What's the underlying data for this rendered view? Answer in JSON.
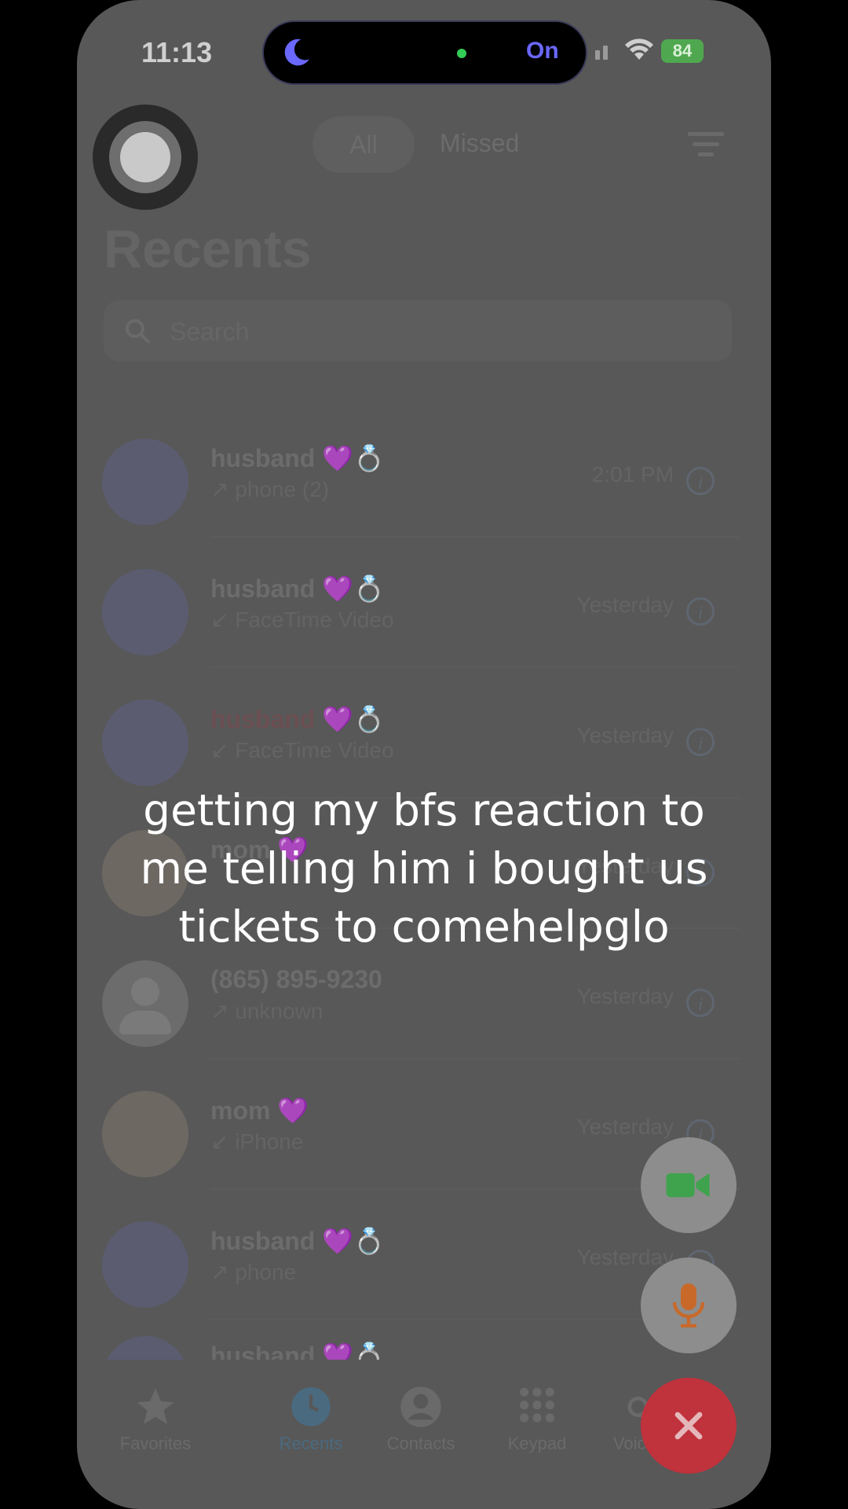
{
  "status_bar": {
    "time": "11:13",
    "focus_label": "On",
    "battery": "84"
  },
  "header": {
    "segments": [
      "All",
      "Missed"
    ],
    "title": "Recents"
  },
  "search": {
    "placeholder": "Search"
  },
  "calls": [
    {
      "name": "husband 💜💍",
      "detail": "↗ phone (2)",
      "time": "2:01 PM",
      "missed": false,
      "avatar": "contact"
    },
    {
      "name": "husband 💜💍",
      "detail": "↙ FaceTime Video",
      "time": "Yesterday",
      "missed": false,
      "avatar": "contact"
    },
    {
      "name": "husband 💜💍",
      "detail": "↙ FaceTime Video",
      "time": "Yesterday",
      "missed": true,
      "avatar": "contact"
    },
    {
      "name": "mom 💜",
      "detail": "",
      "time": "Yesterday",
      "missed": false,
      "avatar": "photo"
    },
    {
      "name": "(865) 895-9230",
      "detail": "↗ unknown",
      "time": "Yesterday",
      "missed": false,
      "avatar": "generic"
    },
    {
      "name": "mom 💜",
      "detail": "↙ iPhone",
      "time": "Yesterday",
      "missed": false,
      "avatar": "photo"
    },
    {
      "name": "husband 💜💍",
      "detail": "↗ phone",
      "time": "Yesterday",
      "missed": false,
      "avatar": "contact"
    },
    {
      "name": "husband 💜💍",
      "detail": "",
      "time": "",
      "missed": false,
      "avatar": "contact"
    }
  ],
  "tabs": [
    "Favorites",
    "Recents",
    "Contacts",
    "Keypad",
    "Voicemail"
  ],
  "overlay": {
    "caption_lines": [
      "getting my bfs reaction to",
      "me telling him i bought us",
      "tickets to comehelpglo"
    ]
  },
  "colors": {
    "focus_accent": "#6a68ff",
    "battery_green": "#4fa84f",
    "facetime_green": "#3fa34d",
    "mic_orange": "#c8692a",
    "end_red": "#c0323c"
  },
  "icons": {
    "video_button": "video-camera-icon",
    "mic_button": "microphone-icon",
    "end_button": "close-icon"
  }
}
